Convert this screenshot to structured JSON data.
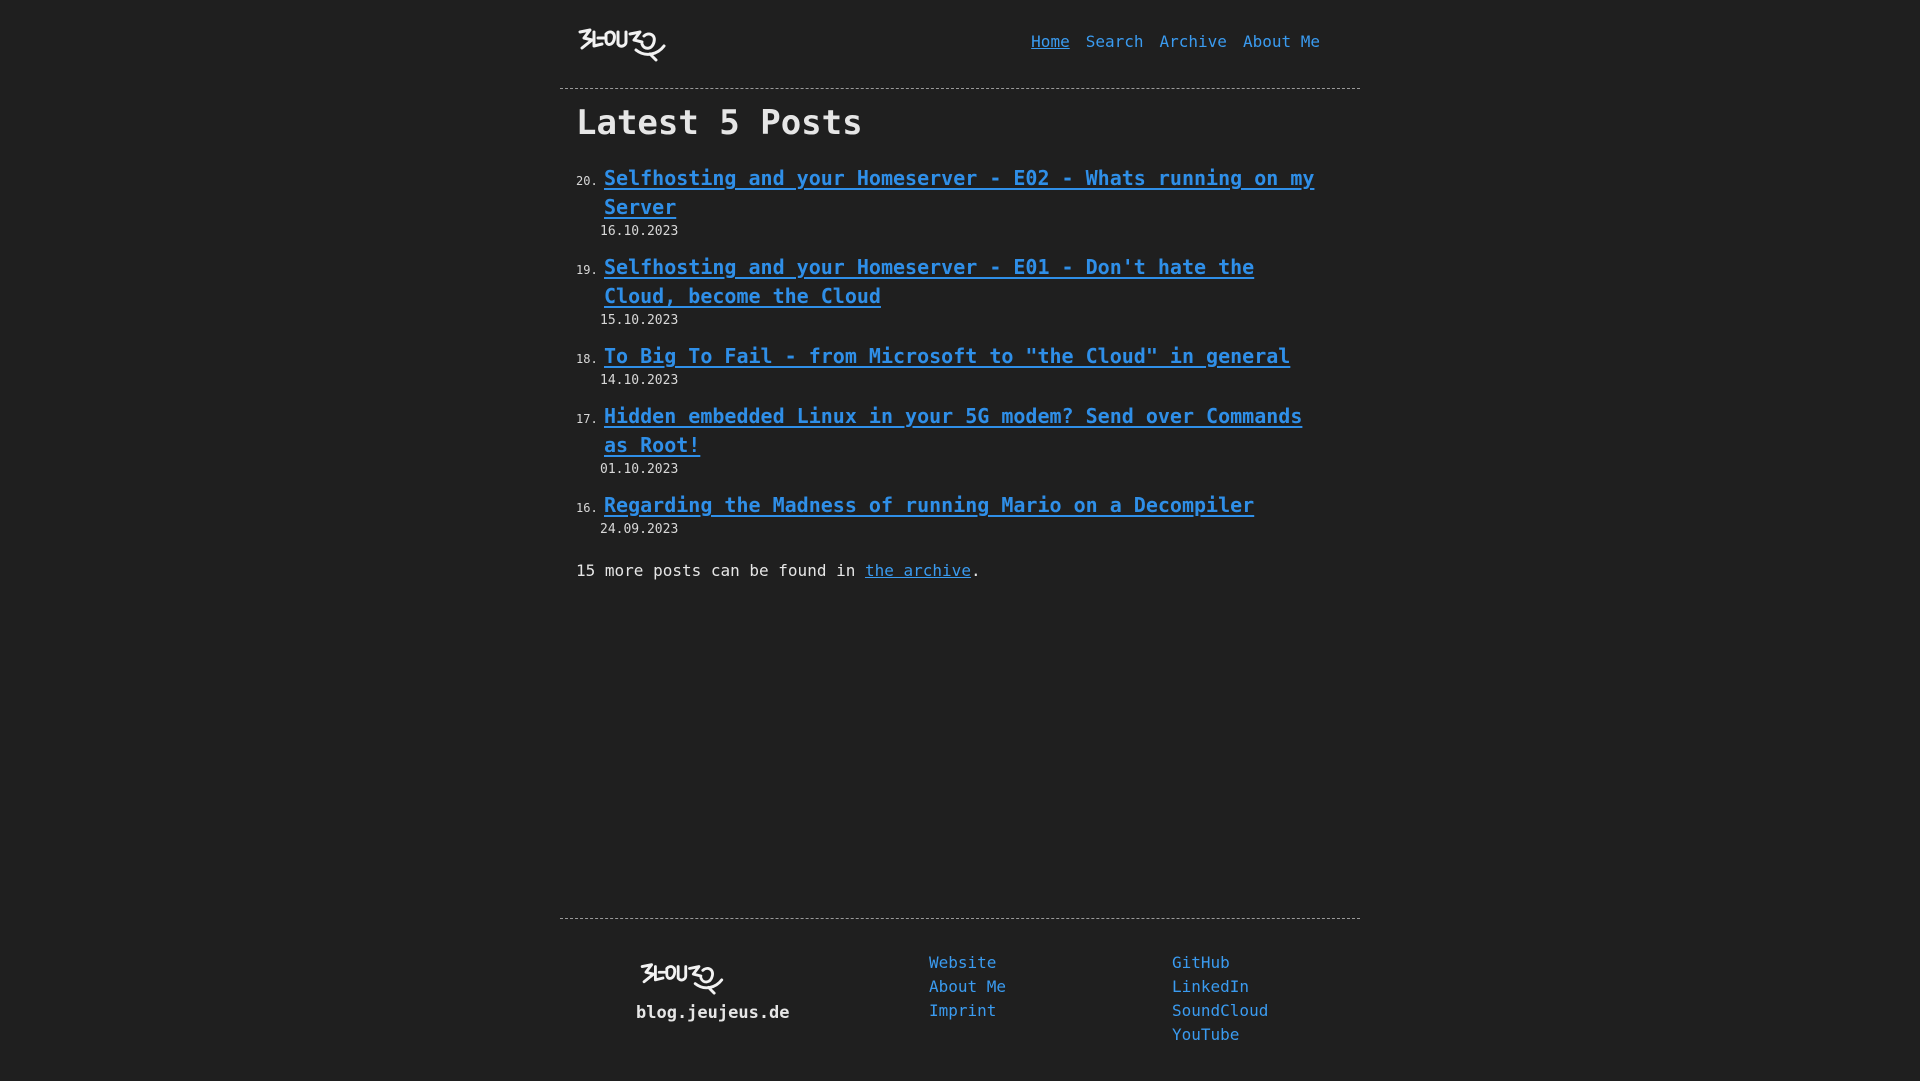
{
  "header": {
    "logo_alt": "JEUJEUS",
    "nav": [
      {
        "label": "Home",
        "active": true
      },
      {
        "label": "Search",
        "active": false
      },
      {
        "label": "Archive",
        "active": false
      },
      {
        "label": "About Me",
        "active": false
      }
    ]
  },
  "main": {
    "title": "Latest 5 Posts",
    "posts": [
      {
        "num": "20.",
        "title": "Selfhosting and your Homeserver - E02 - Whats running on my Server",
        "date": "16.10.2023"
      },
      {
        "num": "19.",
        "title": "Selfhosting and your Homeserver - E01 - Don't hate the Cloud, become the Cloud",
        "date": "15.10.2023"
      },
      {
        "num": "18.",
        "title": "To Big To Fail - from Microsoft to \"the Cloud\" in general",
        "date": "14.10.2023"
      },
      {
        "num": "17.",
        "title": "Hidden embedded Linux in your 5G modem? Send over Commands as Root!",
        "date": "01.10.2023"
      },
      {
        "num": "16.",
        "title": "Regarding the Madness of running Mario on a Decompiler",
        "date": "24.09.2023"
      }
    ],
    "more_prefix": "15 more posts can be found in ",
    "more_link": "the archive",
    "more_suffix": "."
  },
  "footer": {
    "site": "blog.jeujeus.de",
    "col1": [
      "Website",
      "About Me",
      "Imprint"
    ],
    "col2": [
      "GitHub",
      "LinkedIn",
      "SoundCloud",
      "YouTube"
    ]
  },
  "colors": {
    "background": "#1f1f1f",
    "link": "#3a9bf0",
    "text": "#e6e6e6"
  }
}
